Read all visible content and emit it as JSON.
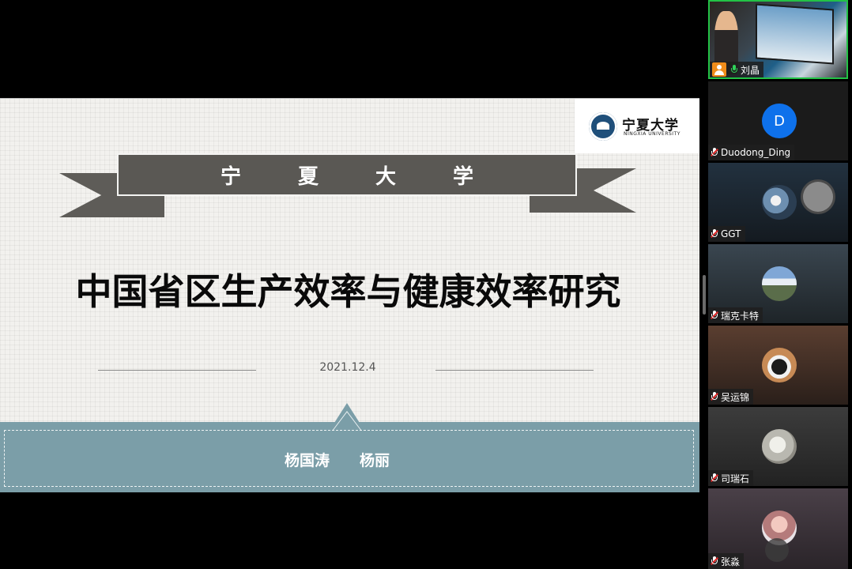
{
  "slide": {
    "logo_cn": "宁夏大学",
    "logo_en": "NINGXIA UNIVERSITY",
    "ribbon_chars": [
      "宁",
      "夏",
      "大",
      "学"
    ],
    "title": "中国省区生产效率与健康效率研究",
    "date": "2021.12.4",
    "authors": [
      "杨国涛",
      "杨丽"
    ],
    "colors": {
      "ribbon": "#5a5854",
      "banner": "#7b9ea8"
    }
  },
  "participants": [
    {
      "name": "刘晶",
      "type": "video",
      "mic": "on",
      "active": true
    },
    {
      "name": "Duodong_Ding",
      "type": "letter",
      "initial": "D",
      "mic": "muted"
    },
    {
      "name": "GGT",
      "type": "photo",
      "mic": "muted",
      "photo": "cat-photo"
    },
    {
      "name": "瑞克卡特",
      "type": "photo",
      "mic": "muted",
      "photo": "mountain-photo"
    },
    {
      "name": "吴运锦",
      "type": "photo",
      "mic": "muted",
      "photo": "cat-photo"
    },
    {
      "name": "司瑞石",
      "type": "photo",
      "mic": "muted",
      "photo": "seal-photo"
    },
    {
      "name": "张淼",
      "type": "photo",
      "mic": "muted",
      "photo": "person-photo"
    }
  ]
}
